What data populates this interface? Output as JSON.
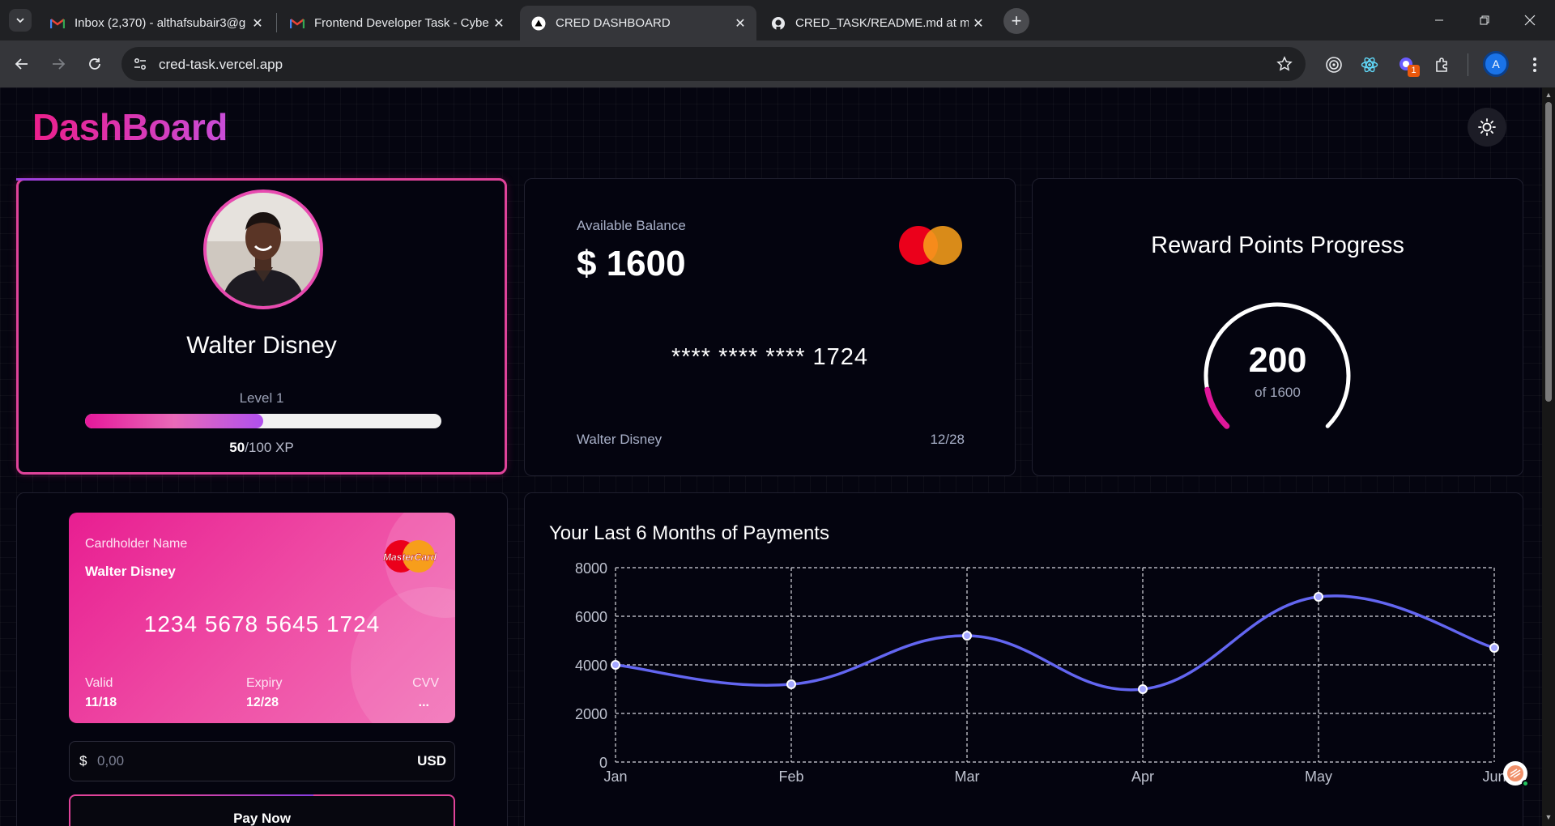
{
  "browser": {
    "tabs": [
      {
        "title": "Inbox (2,370) - althafsubair3@g",
        "icon": "gmail-icon"
      },
      {
        "title": "Frontend Developer Task - Cybe",
        "icon": "gmail-icon"
      },
      {
        "title": "CRED DASHBOARD",
        "icon": "vercel-icon"
      },
      {
        "title": "CRED_TASK/README.md at ma",
        "icon": "github-icon"
      }
    ],
    "active_tab": 2,
    "url": "cred-task.vercel.app",
    "extension_badge": "1",
    "profile_initial": "A"
  },
  "header": {
    "title": "DashBoard"
  },
  "profile": {
    "name": "Walter Disney",
    "level": "Level 1",
    "xp_current": "50",
    "xp_total": "/100 XP",
    "xp_fraction": 0.5
  },
  "balance": {
    "label": "Available Balance",
    "amount": "$ 1600",
    "masked_number": "**** **** **** 1724",
    "holder": "Walter Disney",
    "expiry": "12/28"
  },
  "reward": {
    "title": "Reward Points Progress",
    "value": "200",
    "of_text": "of 1600",
    "fraction": 0.125
  },
  "payment_card": {
    "holder_label": "Cardholder Name",
    "holder": "Walter Disney",
    "brand": "MasterCard",
    "number": "1234 5678 5645 1724",
    "valid_label": "Valid",
    "valid": "11/18",
    "expiry_label": "Expiry",
    "expiry": "12/28",
    "cvv_label": "CVV",
    "cvv": "..."
  },
  "amount_input": {
    "currency_symbol": "$",
    "placeholder": "0,00",
    "currency": "USD"
  },
  "pay_button": "Pay Now",
  "colors": {
    "accent": "#ec1f8b",
    "line": "#6366f1",
    "gauge_track": "#ffffff"
  },
  "chart_data": {
    "type": "line",
    "title": "Your Last 6 Months of Payments",
    "categories": [
      "Jan",
      "Feb",
      "Mar",
      "Apr",
      "May",
      "Jun"
    ],
    "series": [
      {
        "values": [
          4000,
          3200,
          5200,
          3000,
          6800,
          4700
        ]
      }
    ],
    "ylim": [
      0,
      8000
    ],
    "yticks": [
      0,
      2000,
      4000,
      6000,
      8000
    ],
    "grid": true
  }
}
